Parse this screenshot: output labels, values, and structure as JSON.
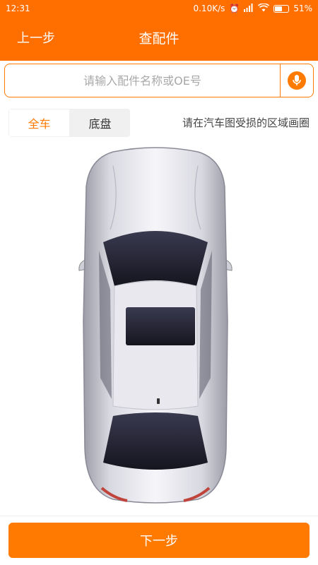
{
  "status_bar": {
    "time": "12:31",
    "network_speed": "0.10K/s",
    "battery": "51%"
  },
  "header": {
    "back_label": "上一步",
    "title": "查配件"
  },
  "search": {
    "placeholder": "请输入配件名称或OE号",
    "mic_icon": "microphone-icon"
  },
  "tabs": [
    {
      "label": "全车",
      "active": true
    },
    {
      "label": "底盘",
      "active": false
    }
  ],
  "hint": "请在汽车图受损的区域画圈",
  "next_button": "下一步",
  "colors": {
    "accent": "#ff7a00",
    "header_bg": "#ff6f00",
    "tab_inactive_bg": "#f0f0f0"
  }
}
